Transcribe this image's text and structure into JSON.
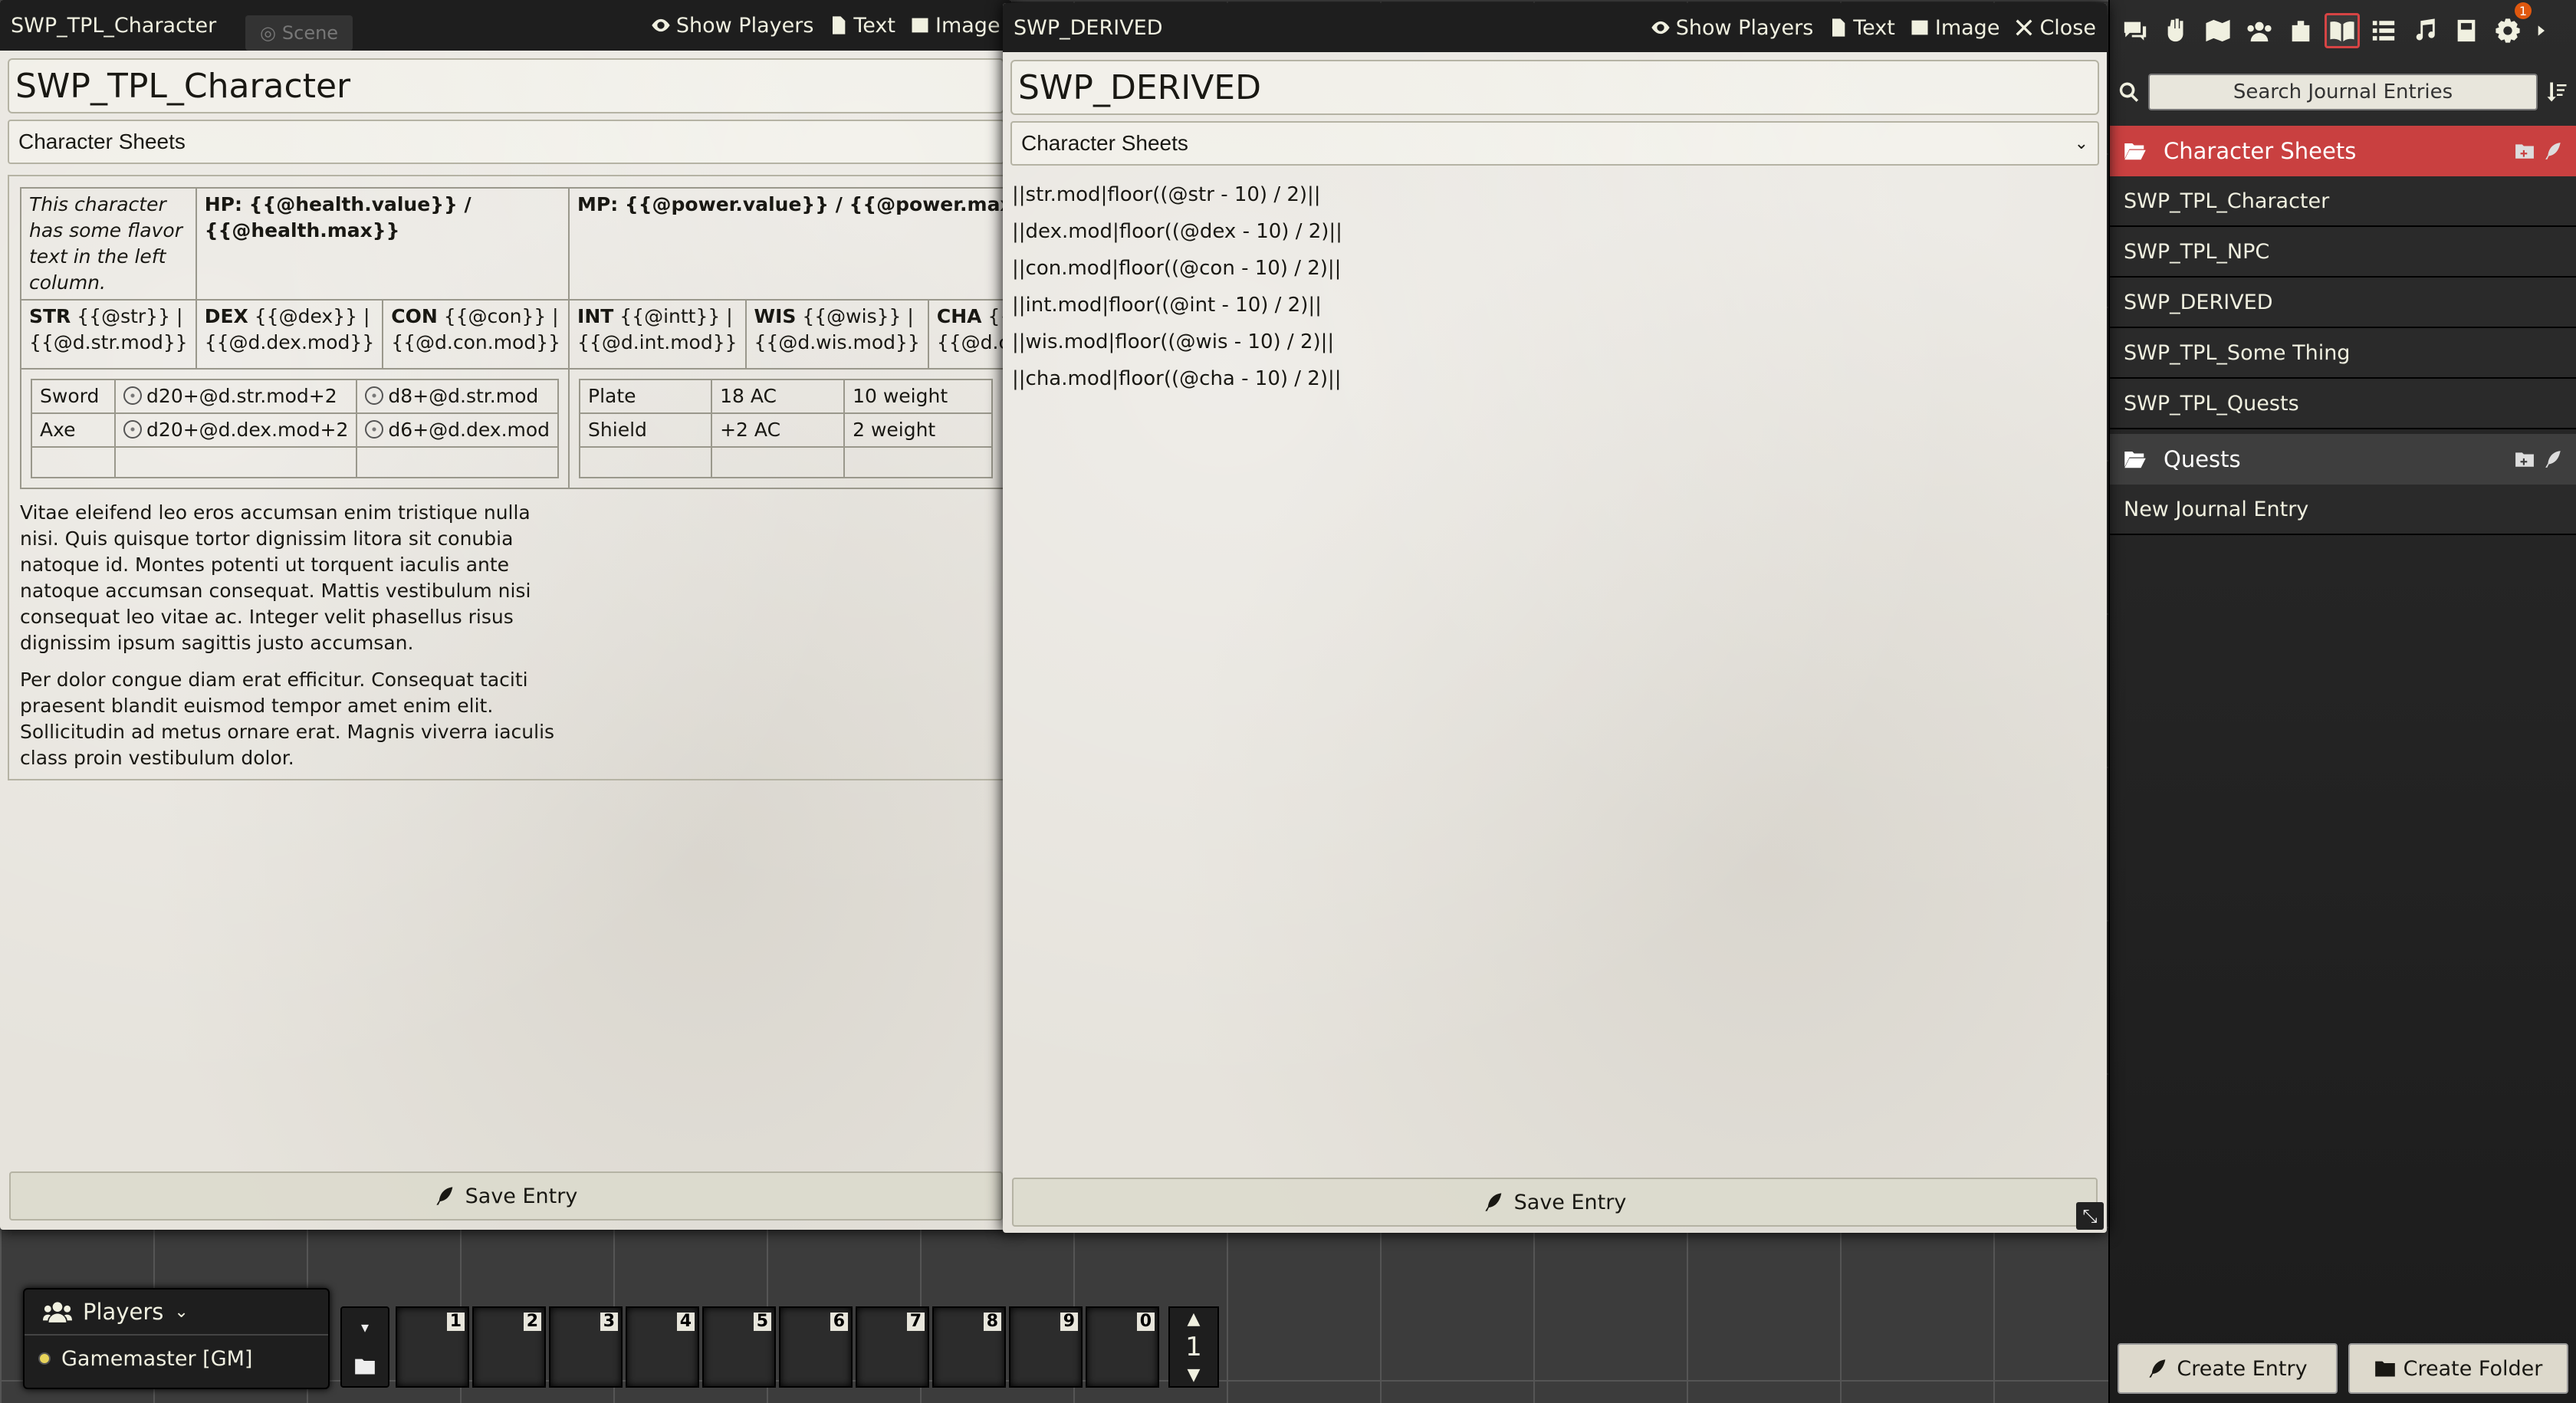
{
  "window1": {
    "title": "SWP_TPL_Character",
    "scene_tab": "Scene",
    "controls": {
      "show_players": "Show Players",
      "text": "Text",
      "image": "Image"
    },
    "name": "SWP_TPL_Character",
    "folder": "Character Sheets",
    "flavor": "This character has some flavor text in the left column.",
    "hp": "HP: {{@health.value}} / {{@health.max}}",
    "mp": "MP: {{@power.value}} / {{@power.max}}",
    "stats": [
      {
        "label": "STR",
        "text": "{{@str}} | {{@d.str.mod}}"
      },
      {
        "label": "DEX",
        "text": "{{@dex}} | {{@d.dex.mod}}"
      },
      {
        "label": "CON",
        "text": "{{@con}} | {{@d.con.mod}}"
      },
      {
        "label": "INT",
        "text": "{{@intt}} | {{@d.int.mod}}"
      },
      {
        "label": "WIS",
        "text": "{{@wis}} | {{@d.wis.mod}}"
      },
      {
        "label": "CHA",
        "text": "{{@cha}} | {{@d.cha.mod}}"
      }
    ],
    "weapons": [
      {
        "name": "Sword",
        "attack": "d20+@d.str.mod+2",
        "damage": "d8+@d.str.mod"
      },
      {
        "name": "Axe",
        "attack": "d20+@d.dex.mod+2",
        "damage": "d6+@d.dex.mod"
      }
    ],
    "armor": [
      {
        "name": "Plate",
        "ac": "18 AC",
        "weight": "10 weight"
      },
      {
        "name": "Shield",
        "ac": "+2 AC",
        "weight": "2 weight"
      }
    ],
    "paragraph1": "Vitae eleifend leo eros accumsan enim tristique nulla nisi. Quis quisque tortor dignissim litora sit conubia natoque id. Montes potenti ut torquent iaculis ante natoque accumsan consequat. Mattis vestibulum nisi consequat leo vitae ac. Integer velit phasellus risus dignissim ipsum sagittis justo accumsan.",
    "paragraph2": "Per dolor congue diam erat efficitur. Consequat taciti praesent blandit euismod tempor amet enim elit. Sollicitudin ad metus ornare erat. Magnis viverra iaculis class proin vestibulum dolor.",
    "save": "Save Entry"
  },
  "window2": {
    "title": "SWP_DERIVED",
    "controls": {
      "show_players": "Show Players",
      "text": "Text",
      "image": "Image",
      "close": "Close"
    },
    "name": "SWP_DERIVED",
    "folder": "Character Sheets",
    "lines": [
      "||str.mod|floor((@str - 10) / 2)||",
      "||dex.mod|floor((@dex - 10) / 2)||",
      "||con.mod|floor((@con - 10) / 2)||",
      "||int.mod|floor((@int - 10) / 2)||",
      "||wis.mod|floor((@wis - 10) / 2)||",
      "||cha.mod|floor((@cha - 10) / 2)||"
    ],
    "save": "Save Entry"
  },
  "sidebar": {
    "tabs": [
      "chat-icon",
      "combat-icon",
      "scenes-icon",
      "actors-icon",
      "items-icon",
      "journal-icon",
      "tables-icon",
      "playlists-icon",
      "compendium-icon",
      "settings-icon",
      "collapse-icon"
    ],
    "notification_count": "1",
    "search_placeholder": "Search Journal Entries",
    "folders": [
      {
        "name": "Character Sheets",
        "color": "#c94040",
        "entries": [
          "SWP_TPL_Character",
          "SWP_TPL_NPC",
          "SWP_DERIVED",
          "SWP_TPL_Some Thing",
          "SWP_TPL_Quests"
        ]
      },
      {
        "name": "Quests",
        "color": "#3e3e3e",
        "entries": [
          "New Journal Entry"
        ]
      }
    ],
    "create_entry": "Create Entry",
    "create_folder": "Create Folder"
  },
  "players": {
    "title": "Players",
    "list": [
      {
        "name": "Gamemaster [GM]"
      }
    ]
  },
  "hotbar": {
    "slots": [
      "1",
      "2",
      "3",
      "4",
      "5",
      "6",
      "7",
      "8",
      "9",
      "0"
    ],
    "page": "1"
  }
}
